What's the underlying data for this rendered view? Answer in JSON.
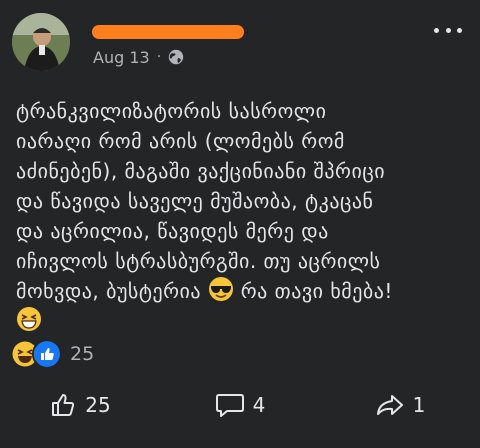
{
  "post": {
    "date": "Aug 13",
    "separator": "·",
    "audience_icon": "globe-icon",
    "text_lines": [
      "ტრანკვილიზატორის სასროლი",
      "იარაღი რომ არის (ლომებს რომ",
      "აძინებენ), მაგაში ვაქცინიანი შპრიცი",
      "და წავიდა საველე მუშაობა, ტკაცან",
      "და აცრილია, წავიდეს მერე და",
      "იჩივლოს სტრასბურგში. თუ აცრილს",
      "მოხვდა, ბუსტერია",
      "რა თავი ხმება!"
    ]
  },
  "reactions": {
    "count": "25",
    "icons": [
      "laughing-face-icon",
      "thumbs-up-icon"
    ]
  },
  "actions": {
    "like_count": "25",
    "comment_count": "4",
    "share_count": "1"
  },
  "colors": {
    "background": "#242526",
    "text": "#e4e6eb",
    "muted": "#b0b3b8",
    "redaction": "#ff7f1f",
    "like_blue": "#1877f2"
  }
}
